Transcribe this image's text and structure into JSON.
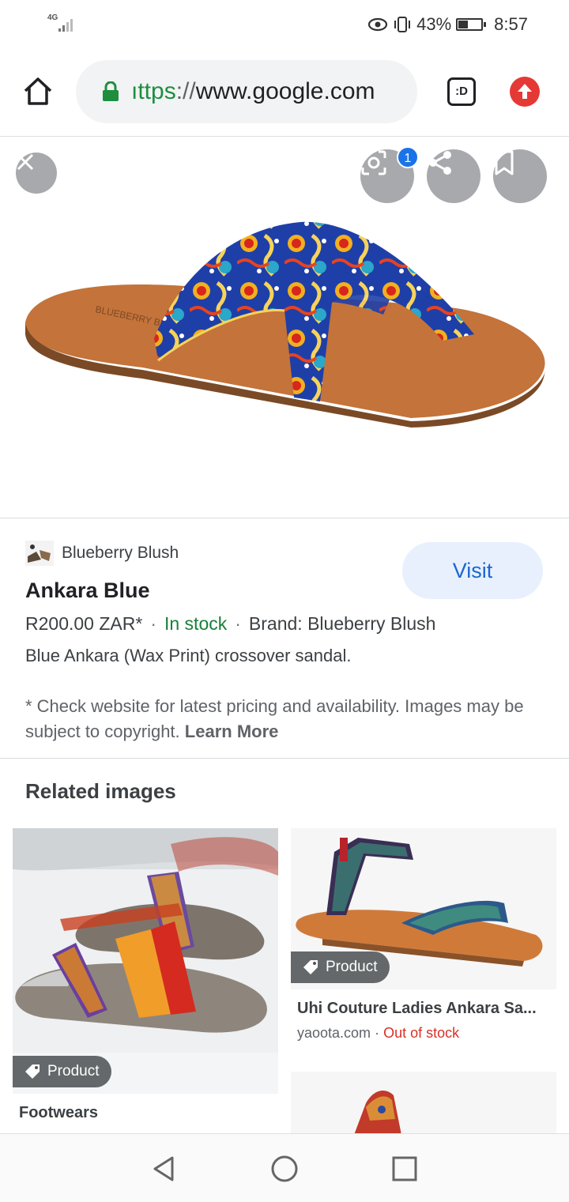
{
  "status_bar": {
    "network": "4G",
    "battery": "43%",
    "time": "8:57"
  },
  "browser": {
    "url_scheme": "ıttps",
    "url_separator": "://",
    "url_host": "www.google.com",
    "tabs_label": ":D"
  },
  "viewer": {
    "lens_badge": "1"
  },
  "product": {
    "source": "Blueberry Blush",
    "visit_label": "Visit",
    "title": "Ankara Blue",
    "price": "R200.00 ZAR*",
    "stock": "In stock",
    "brand": "Brand: Blueberry Blush",
    "separator": "·",
    "description": "Blue Ankara (Wax Print) crossover sandal.",
    "disclaimer": "* Check website for latest pricing and availability. Images may be subject to copyright.",
    "learn_more": "Learn More"
  },
  "related": {
    "title": "Related images",
    "items": [
      {
        "chip": "Product",
        "caption": "Footwears"
      },
      {
        "chip": "Product",
        "title": "Uhi Couture Ladies Ankara Sa...",
        "source": "yaoota.com",
        "availability": "Out of stock"
      }
    ]
  },
  "colors": {
    "accent_blue": "#1967d2",
    "in_stock": "#188038",
    "out_of_stock": "#d93025"
  }
}
